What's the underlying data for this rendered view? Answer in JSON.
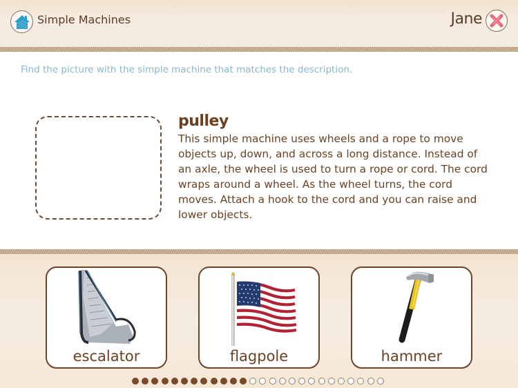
{
  "header": {
    "app_title": "Simple Machines",
    "home_icon": "house-icon",
    "user_name": "Jane",
    "close_icon": "close-x-icon"
  },
  "instruction": "Find the picture with the simple machine that matches the description.",
  "question": {
    "word": "pulley",
    "description": "This simple machine uses wheels and a rope to move objects up, down, and across a long distance. Instead of an axle, the wheel is used to turn a rope or cord. The cord wraps around a wheel. As the wheel turns, the cord moves. Attach a hook to the cord and you can raise and lower objects."
  },
  "choices": [
    {
      "label": "escalator",
      "image": "escalator-image"
    },
    {
      "label": "flagpole",
      "image": "flagpole-image"
    },
    {
      "label": "hammer",
      "image": "hammer-image"
    }
  ],
  "progress": {
    "completed": 12,
    "total": 26
  },
  "colors": {
    "brown_text": "#6b4124",
    "instruction_blue": "#88b6cf",
    "home_blue": "#2f9fc9",
    "close_red": "#e8677b",
    "dot_filled": "#7a4a28"
  }
}
